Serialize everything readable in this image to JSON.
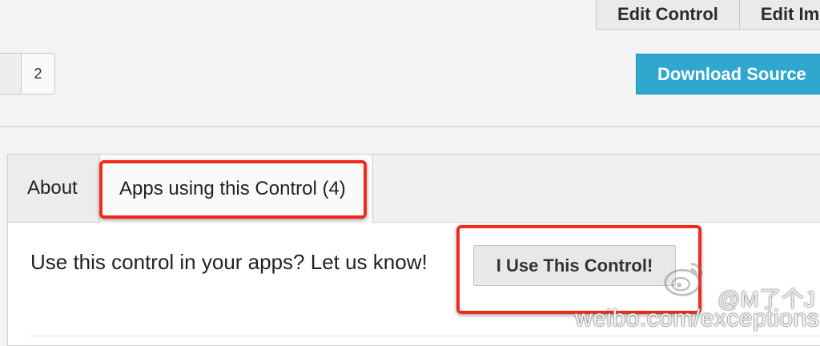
{
  "toolbar": {
    "edit_control_label": "Edit Control",
    "edit_images_label": "Edit Im"
  },
  "pagination": {
    "page_label": "2"
  },
  "download": {
    "label": "Download Source"
  },
  "tabs": [
    {
      "label": "About",
      "active": false
    },
    {
      "label": "Apps using this Control (4)",
      "active": true
    }
  ],
  "panel": {
    "prompt": "Use this control in your apps? Let us know!",
    "button_label": "I Use This Control!"
  },
  "annotations": {
    "highlight_color": "#ef2b1e"
  },
  "watermark": {
    "handle": "@M了个J",
    "url": "weibo.com/exceptions",
    "logo_icon": "weibo-logo-icon"
  },
  "colors": {
    "download_button": "#2fa7cf",
    "background": "#f3f3f3"
  }
}
